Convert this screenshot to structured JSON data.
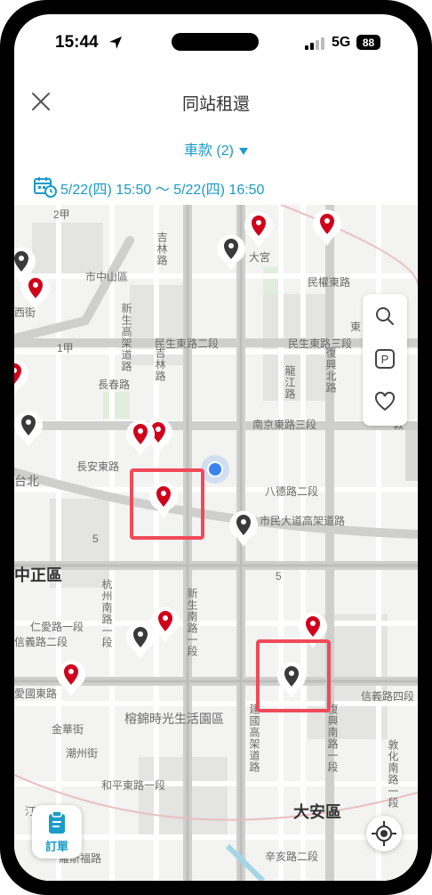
{
  "status": {
    "time": "15:44",
    "network": "5G",
    "battery": "88"
  },
  "header": {
    "title": "同站租還"
  },
  "filter": {
    "car_label": "車款 (2)"
  },
  "date": {
    "range": "5/22(四) 15:50 ～ 5/22(四) 16:50"
  },
  "map": {
    "district_labels": [
      "中正區",
      "大安區"
    ],
    "street_labels": [
      "2甲",
      "吉林路",
      "大宮",
      "民權東路",
      "市中山區",
      "西街",
      "民生東路二段",
      "民生東路三段",
      "1甲",
      "長春路",
      "南京東路三段",
      "敦",
      "長安東路",
      "台北",
      "八德路二段",
      "市民大道高架道路",
      "5",
      "5",
      "仁愛路一段",
      "信義路二段",
      "杭州南路一段",
      "信義路四段",
      "榕錦時光生活園區",
      "愛國東路",
      "金華街",
      "潮州街",
      "和平東路一段",
      "汀州路",
      "辛亥路二段",
      "新生高架道路",
      "吉林路",
      "龍江路",
      "復興北路",
      "建國高架道路",
      "新生南路一段",
      "復興南路一段",
      "敦化南路一段",
      "羅斯福路",
      "東"
    ]
  },
  "tools": {
    "search": "search-icon",
    "parking": "P",
    "favorite": "heart-icon"
  },
  "order": {
    "label": "訂單"
  },
  "colors": {
    "accent": "#1a9bc9",
    "pin_red": "#d0021b",
    "pin_gray": "#3a3a3a",
    "highlight": "#f04a58"
  }
}
